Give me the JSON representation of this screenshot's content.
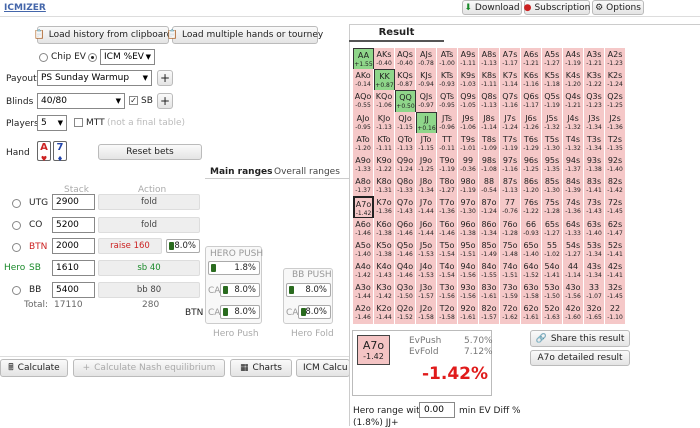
{
  "app": {
    "title": "ICMIZER"
  },
  "topbar": {
    "download": "Download",
    "subscription": "Subscription",
    "options": "Options"
  },
  "toolbar": {
    "load_history": "Load history from clipboard",
    "load_multiple": "Load multiple hands or tourney"
  },
  "mode": {
    "chip_ev": "Chip EV",
    "icm_selected": "ICM %EV"
  },
  "settings": {
    "payout_label": "Payout",
    "payout_value": "PS Sunday Warmup",
    "blinds_label": "Blinds",
    "blinds_value": "40/80",
    "sb_label": "SB",
    "players_label": "Players",
    "players_value": "5",
    "mtt_label": "MTT",
    "mtt_note": "(not a final table)"
  },
  "hand": {
    "label": "Hand",
    "card1": "A",
    "card2": "7",
    "reset": "Reset bets"
  },
  "tabs": {
    "main": "Main ranges",
    "overall": "Overall ranges"
  },
  "table_headers": {
    "stack": "Stack",
    "action": "Action"
  },
  "players": [
    {
      "pos": "UTG",
      "stack": "2900",
      "action": "fold"
    },
    {
      "pos": "CO",
      "stack": "5200",
      "action": "fold"
    },
    {
      "pos": "BTN",
      "stack": "2000",
      "action": "raise 160",
      "pct": "8.0%"
    },
    {
      "pos": "SB",
      "hero": "Hero",
      "stack": "1610",
      "action": "sb 40"
    },
    {
      "pos": "BB",
      "stack": "5400",
      "action": "bb 80"
    }
  ],
  "totals": {
    "label": "Total:",
    "stack": "17110",
    "action": "280"
  },
  "hero_push": {
    "title": "HERO PUSH",
    "val1": "1.8%",
    "ca1": "CA",
    "val2": "8.0%",
    "ca2": "CA",
    "val3": "8.0%",
    "footer": "Hero Push"
  },
  "bb_push": {
    "title": "BB PUSH",
    "val1": "8.0%",
    "ca1": "CA",
    "val2": "8.0%",
    "footer": "Hero Fold",
    "btn_label": "BTN"
  },
  "bottom": {
    "calculate": "Calculate",
    "nash": "Calculate Nash equilibrium",
    "charts": "Charts",
    "icm_calc": "ICM Calcu"
  },
  "result": {
    "tab": "Result",
    "hand": "A7o",
    "hand_ev": "-1.42",
    "evpush_label": "EvPush",
    "evpush": "5.70%",
    "evfold_label": "EvFold",
    "evfold": "7.12%",
    "big": "-1.42%",
    "share": "Share this result",
    "detail": "A7o detailed result",
    "hero_range_label": "Hero range with",
    "hero_range_val": "0.00",
    "hero_range_suffix": "min EV Diff %",
    "range_note": "(1.8%) JJ+"
  },
  "grid": [
    [
      [
        "AA",
        "+1.55"
      ],
      [
        "AKs",
        "-0.40"
      ],
      [
        "AQs",
        "-0.40"
      ],
      [
        "AJs",
        "-0.78"
      ],
      [
        "ATs",
        "-1.00"
      ],
      [
        "A9s",
        "-1.11"
      ],
      [
        "A8s",
        "-1.13"
      ],
      [
        "A7s",
        "-1.17"
      ],
      [
        "A6s",
        "-1.21"
      ],
      [
        "A5s",
        "-1.27"
      ],
      [
        "A4s",
        "-1.19"
      ],
      [
        "A3s",
        "-1.21"
      ],
      [
        "A2s",
        "-1.23"
      ]
    ],
    [
      [
        "AKo",
        "-0.14"
      ],
      [
        "KK",
        "+0.87"
      ],
      [
        "KQs",
        "-0.87"
      ],
      [
        "KJs",
        "-0.94"
      ],
      [
        "KTs",
        "-0.93"
      ],
      [
        "K9s",
        "-1.03"
      ],
      [
        "K8s",
        "-1.11"
      ],
      [
        "K7s",
        "-1.14"
      ],
      [
        "K6s",
        "-1.16"
      ],
      [
        "K5s",
        "-1.18"
      ],
      [
        "K4s",
        "-1.20"
      ],
      [
        "K3s",
        "-1.22"
      ],
      [
        "K2s",
        "-1.24"
      ]
    ],
    [
      [
        "AQo",
        "-0.55"
      ],
      [
        "KQo",
        "-1.06"
      ],
      [
        "QQ",
        "+0.50"
      ],
      [
        "QJs",
        "-0.97"
      ],
      [
        "QTs",
        "-0.95"
      ],
      [
        "Q9s",
        "-1.05"
      ],
      [
        "Q8s",
        "-1.13"
      ],
      [
        "Q7s",
        "-1.16"
      ],
      [
        "Q6s",
        "-1.17"
      ],
      [
        "Q5s",
        "-1.19"
      ],
      [
        "Q4s",
        "-1.21"
      ],
      [
        "Q3s",
        "-1.23"
      ],
      [
        "Q2s",
        "-1.25"
      ]
    ],
    [
      [
        "AJo",
        "-0.95"
      ],
      [
        "KJo",
        "-1.13"
      ],
      [
        "QJo",
        "-1.15"
      ],
      [
        "JJ",
        "+0.16"
      ],
      [
        "JTs",
        "-0.96"
      ],
      [
        "J9s",
        "-1.06"
      ],
      [
        "J8s",
        "-1.14"
      ],
      [
        "J7s",
        "-1.24"
      ],
      [
        "J6s",
        "-1.26"
      ],
      [
        "J5s",
        "-1.32"
      ],
      [
        "J4s",
        "-1.32"
      ],
      [
        "J3s",
        "-1.34"
      ],
      [
        "J2s",
        "-1.36"
      ]
    ],
    [
      [
        "ATo",
        "-1.20"
      ],
      [
        "KTo",
        "-1.11"
      ],
      [
        "QTo",
        "-1.13"
      ],
      [
        "JTo",
        "-1.15"
      ],
      [
        "TT",
        "-0.11"
      ],
      [
        "T9s",
        "-1.01"
      ],
      [
        "T8s",
        "-1.09"
      ],
      [
        "T7s",
        "-1.19"
      ],
      [
        "T6s",
        "-1.29"
      ],
      [
        "T5s",
        "-1.30"
      ],
      [
        "T4s",
        "-1.32"
      ],
      [
        "T3s",
        "-1.34"
      ],
      [
        "T2s",
        "-1.35"
      ]
    ],
    [
      [
        "A9o",
        "-1.33"
      ],
      [
        "K9o",
        "-1.22"
      ],
      [
        "Q9o",
        "-1.24"
      ],
      [
        "J9o",
        "-1.25"
      ],
      [
        "T9o",
        "-1.19"
      ],
      [
        "99",
        "-0.36"
      ],
      [
        "98s",
        "-1.08"
      ],
      [
        "97s",
        "-1.16"
      ],
      [
        "96s",
        "-1.25"
      ],
      [
        "95s",
        "-1.35"
      ],
      [
        "94s",
        "-1.37"
      ],
      [
        "93s",
        "-1.38"
      ],
      [
        "92s",
        "-1.40"
      ]
    ],
    [
      [
        "A8o",
        "-1.37"
      ],
      [
        "K8o",
        "-1.31"
      ],
      [
        "Q8o",
        "-1.33"
      ],
      [
        "J8o",
        "-1.34"
      ],
      [
        "T8o",
        "-1.27"
      ],
      [
        "98o",
        "-1.19"
      ],
      [
        "88",
        "-0.54"
      ],
      [
        "87s",
        "-1.13"
      ],
      [
        "86s",
        "-1.20"
      ],
      [
        "85s",
        "-1.30"
      ],
      [
        "84s",
        "-1.39"
      ],
      [
        "83s",
        "-1.41"
      ],
      [
        "82s",
        "-1.42"
      ]
    ],
    [
      [
        "A7o",
        "-1.42"
      ],
      [
        "K7o",
        "-1.36"
      ],
      [
        "Q7o",
        "-1.43"
      ],
      [
        "J7o",
        "-1.44"
      ],
      [
        "T7o",
        "-1.36"
      ],
      [
        "97o",
        "-1.30"
      ],
      [
        "87o",
        "-1.24"
      ],
      [
        "77",
        "-0.76"
      ],
      [
        "76s",
        "-1.22"
      ],
      [
        "75s",
        "-1.28"
      ],
      [
        "74s",
        "-1.36"
      ],
      [
        "73s",
        "-1.43"
      ],
      [
        "72s",
        "-1.45"
      ]
    ],
    [
      [
        "A6o",
        "-1.46"
      ],
      [
        "K6o",
        "-1.38"
      ],
      [
        "Q6o",
        "-1.46"
      ],
      [
        "J6o",
        "-1.44"
      ],
      [
        "T6o",
        "-1.46"
      ],
      [
        "96o",
        "-1.38"
      ],
      [
        "86o",
        "-1.34"
      ],
      [
        "76o",
        "-1.28"
      ],
      [
        "66",
        "-0.93"
      ],
      [
        "65s",
        "-1.27"
      ],
      [
        "64s",
        "-1.33"
      ],
      [
        "63s",
        "-1.40"
      ],
      [
        "62s",
        "-1.47"
      ]
    ],
    [
      [
        "A5o",
        "-1.40"
      ],
      [
        "K5o",
        "-1.38"
      ],
      [
        "Q5o",
        "-1.46"
      ],
      [
        "J5o",
        "-1.53"
      ],
      [
        "T5o",
        "-1.54"
      ],
      [
        "95o",
        "-1.51"
      ],
      [
        "85o",
        "-1.49"
      ],
      [
        "75o",
        "-1.48"
      ],
      [
        "65o",
        "-1.40"
      ],
      [
        "55",
        "-1.02"
      ],
      [
        "54s",
        "-1.27"
      ],
      [
        "53s",
        "-1.34"
      ],
      [
        "52s",
        "-1.41"
      ]
    ],
    [
      [
        "A4o",
        "-1.42"
      ],
      [
        "K4o",
        "-1.43"
      ],
      [
        "Q4o",
        "-1.46"
      ],
      [
        "J4o",
        "-1.53"
      ],
      [
        "T4o",
        "-1.54"
      ],
      [
        "94o",
        "-1.56"
      ],
      [
        "84o",
        "-1.55"
      ],
      [
        "74o",
        "-1.51"
      ],
      [
        "64o",
        "-1.52"
      ],
      [
        "54o",
        "-1.41"
      ],
      [
        "44",
        "-1.14"
      ],
      [
        "43s",
        "-1.34"
      ],
      [
        "42s",
        "-1.41"
      ]
    ],
    [
      [
        "A3o",
        "-1.44"
      ],
      [
        "K3o",
        "-1.42"
      ],
      [
        "Q3o",
        "-1.50"
      ],
      [
        "J3o",
        "-1.57"
      ],
      [
        "T3o",
        "-1.56"
      ],
      [
        "93o",
        "-1.56"
      ],
      [
        "83o",
        "-1.61"
      ],
      [
        "73o",
        "-1.59"
      ],
      [
        "63o",
        "-1.58"
      ],
      [
        "53o",
        "-1.50"
      ],
      [
        "43o",
        "-1.56"
      ],
      [
        "33",
        "-1.07"
      ],
      [
        "32s",
        "-1.45"
      ]
    ],
    [
      [
        "A2o",
        "-1.46"
      ],
      [
        "K2o",
        "-1.44"
      ],
      [
        "Q2o",
        "-1.52"
      ],
      [
        "J2o",
        "-1.58"
      ],
      [
        "T2o",
        "-1.58"
      ],
      [
        "92o",
        "-1.61"
      ],
      [
        "82o",
        "-1.57"
      ],
      [
        "72o",
        "-1.62"
      ],
      [
        "62o",
        "-1.61"
      ],
      [
        "52o",
        "-1.63"
      ],
      [
        "42o",
        "-1.60"
      ],
      [
        "32o",
        "-1.65"
      ],
      [
        "22",
        "-1.10"
      ]
    ]
  ]
}
